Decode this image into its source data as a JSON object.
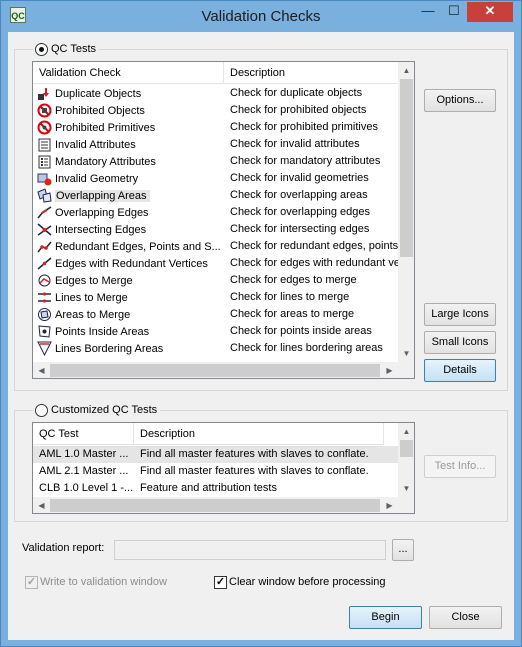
{
  "window": {
    "title": "Validation Checks",
    "app_icon_text": "QC",
    "controls": {
      "minimize": "—",
      "maximize": "☐",
      "close": "✕"
    }
  },
  "qc_tests": {
    "label": "QC Tests",
    "selected": true,
    "columns": [
      "Validation Check",
      "Description"
    ],
    "rows": [
      {
        "name": "Duplicate Objects",
        "desc": "Check for duplicate objects",
        "icon": "duplicate-objects-icon"
      },
      {
        "name": "Prohibited Objects",
        "desc": "Check for prohibited objects",
        "icon": "prohibited-objects-icon"
      },
      {
        "name": "Prohibited Primitives",
        "desc": "Check for prohibited primitives",
        "icon": "prohibited-primitives-icon"
      },
      {
        "name": "Invalid Attributes",
        "desc": "Check for invalid attributes",
        "icon": "invalid-attributes-icon"
      },
      {
        "name": "Mandatory Attributes",
        "desc": "Check for mandatory attributes",
        "icon": "mandatory-attributes-icon"
      },
      {
        "name": "Invalid Geometry",
        "desc": "Check for invalid geometries",
        "icon": "invalid-geometry-icon"
      },
      {
        "name": "Overlapping Areas",
        "desc": "Check for overlapping areas",
        "icon": "overlapping-areas-icon"
      },
      {
        "name": "Overlapping Edges",
        "desc": "Check for overlapping edges",
        "icon": "overlapping-edges-icon"
      },
      {
        "name": "Intersecting Edges",
        "desc": "Check for intersecting edges",
        "icon": "intersecting-edges-icon"
      },
      {
        "name": "Redundant Edges, Points and S...",
        "desc": "Check for redundant edges, points",
        "icon": "redundant-edges-icon"
      },
      {
        "name": "Edges with Redundant Vertices",
        "desc": "Check for edges with redundant ve",
        "icon": "redundant-vertices-icon"
      },
      {
        "name": "Edges to Merge",
        "desc": "Check for edges to merge",
        "icon": "edges-to-merge-icon"
      },
      {
        "name": "Lines to Merge",
        "desc": "Check for lines to merge",
        "icon": "lines-to-merge-icon"
      },
      {
        "name": "Areas to Merge",
        "desc": "Check for areas to merge",
        "icon": "areas-to-merge-icon"
      },
      {
        "name": "Points Inside Areas",
        "desc": "Check for points inside areas",
        "icon": "points-inside-areas-icon"
      },
      {
        "name": "Lines Bordering Areas",
        "desc": "Check for lines bordering areas",
        "icon": "lines-bordering-areas-icon"
      }
    ],
    "buttons": {
      "options": "Options...",
      "large_icons": "Large Icons",
      "small_icons": "Small Icons",
      "details": "Details"
    }
  },
  "custom_qc": {
    "label": "Customized QC Tests",
    "selected": false,
    "columns": [
      "QC Test",
      "Description"
    ],
    "rows": [
      {
        "name": "AML 1.0 Master ...",
        "desc": "Find all master features with slaves to conflate."
      },
      {
        "name": "AML 2.1 Master ...",
        "desc": "Find all master features with slaves to conflate."
      },
      {
        "name": "CLB 1.0 Level 1 -...",
        "desc": "Feature and attribution tests"
      }
    ],
    "test_info_label": "Test Info..."
  },
  "report": {
    "label": "Validation report:",
    "value": "",
    "browse_label": "..."
  },
  "options": {
    "write_label": "Write to validation window",
    "write_checked": true,
    "clear_label": "Clear window before processing",
    "clear_checked": true
  },
  "footer": {
    "begin_label": "Begin",
    "close_label": "Close"
  },
  "colors": {
    "title_bar": "#7ab0dd",
    "close_button": "#c7403a",
    "dialog_bg": "#f0f0f0",
    "default_button": "#c4e0f5",
    "row_selected": "#e5e5e5"
  }
}
